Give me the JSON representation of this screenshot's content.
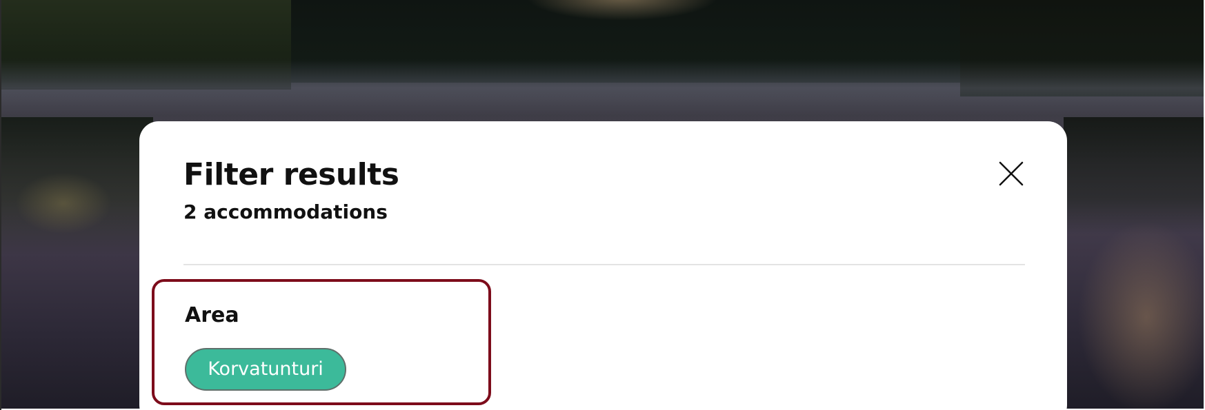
{
  "dialog": {
    "title": "Filter results",
    "subtitle": "2 accommodations",
    "close_icon": "close-icon"
  },
  "filters": {
    "area": {
      "label": "Area",
      "options": [
        {
          "label": "Korvatunturi",
          "selected": true
        }
      ]
    }
  },
  "colors": {
    "chip_background": "#3cba9a",
    "focus_outline": "#7d0c1b",
    "dialog_background": "#ffffff"
  }
}
